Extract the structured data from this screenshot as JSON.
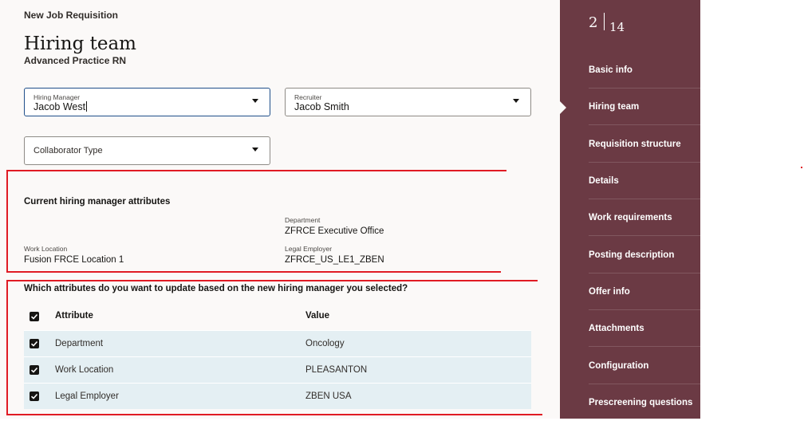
{
  "page": {
    "header": "New Job Requisition",
    "title": "Hiring team",
    "subtitle": "Advanced Practice RN"
  },
  "fields": {
    "hiring_manager": {
      "label": "Hiring Manager",
      "value": "Jacob West"
    },
    "recruiter": {
      "label": "Recruiter",
      "value": "Jacob Smith"
    },
    "collaborator_type": {
      "placeholder": "Collaborator Type"
    }
  },
  "current_attributes": {
    "heading": "Current hiring manager attributes",
    "department": {
      "label": "Department",
      "value": "ZFRCE Executive Office"
    },
    "work_location": {
      "label": "Work Location",
      "value": "Fusion FRCE Location 1"
    },
    "legal_employer": {
      "label": "Legal Employer",
      "value": "ZFRCE_US_LE1_ZBEN"
    }
  },
  "update": {
    "question": "Which attributes do you want to update based on the new hiring manager you selected?",
    "columns": {
      "attribute": "Attribute",
      "value": "Value"
    },
    "rows": [
      {
        "attribute": "Department",
        "value": "Oncology"
      },
      {
        "attribute": "Work Location",
        "value": "PLEASANTON"
      },
      {
        "attribute": "Legal Employer",
        "value": "ZBEN USA"
      }
    ]
  },
  "sidebar": {
    "step_current": "2",
    "step_total": "14",
    "items": [
      {
        "label": "Basic info"
      },
      {
        "label": "Hiring team"
      },
      {
        "label": "Requisition structure"
      },
      {
        "label": "Details"
      },
      {
        "label": "Work requirements"
      },
      {
        "label": "Posting description"
      },
      {
        "label": "Offer info"
      },
      {
        "label": "Attachments"
      },
      {
        "label": "Configuration"
      },
      {
        "label": "Prescreening questions"
      }
    ]
  },
  "colors": {
    "sidebar_bg": "#6b3a44",
    "annotation_red": "#e01b24",
    "row_highlight": "#e4eff3"
  }
}
